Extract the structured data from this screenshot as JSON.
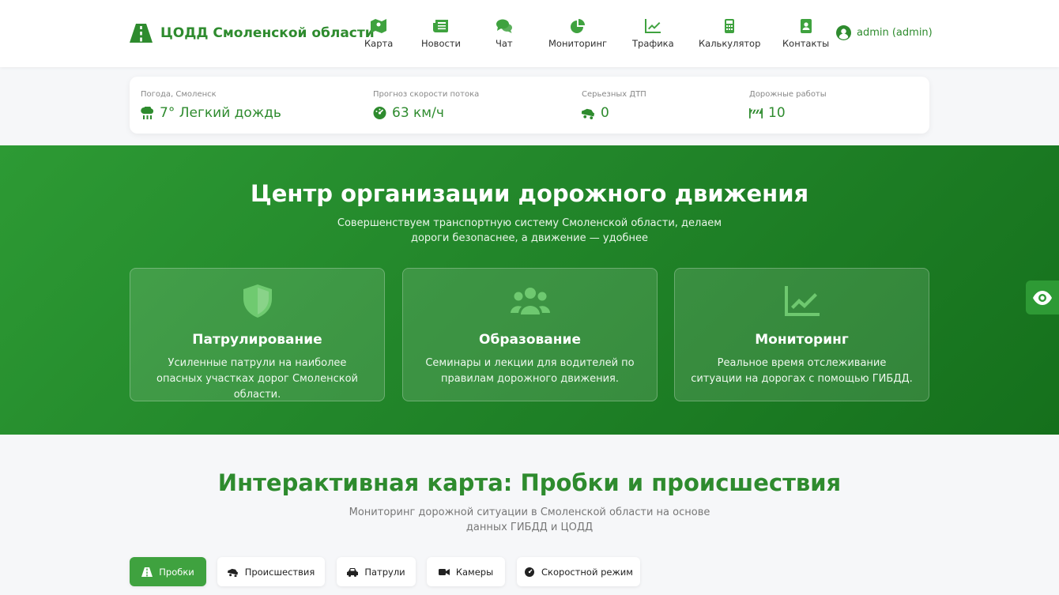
{
  "header": {
    "logo_text": "ЦОДД Смоленской области",
    "nav": [
      {
        "label": "Карта",
        "icon": "map-icon"
      },
      {
        "label": "Новости",
        "icon": "newspaper-icon"
      },
      {
        "label": "Чат",
        "icon": "chat-icon"
      },
      {
        "label": "Мониторинг",
        "icon": "pie-chart-icon"
      },
      {
        "label": "Трафика",
        "icon": "line-chart-icon"
      },
      {
        "label": "Калькулятор",
        "icon": "calculator-icon"
      },
      {
        "label": "Контакты",
        "icon": "contact-book-icon"
      }
    ],
    "user_label": "admin (admin)"
  },
  "infobar": [
    {
      "caption": "Погода, Смоленск",
      "value": "7°  Легкий дождь",
      "icon": "cloud-rain-icon"
    },
    {
      "caption": "Прогноз скорости потока",
      "value": "63 км/ч",
      "icon": "speedometer-icon"
    },
    {
      "caption": "Серьезных ДТП",
      "value": "0",
      "icon": "car-crash-icon"
    },
    {
      "caption": "Дорожные работы",
      "value": "10",
      "icon": "road-barrier-icon"
    }
  ],
  "hero": {
    "title": "Центр организации дорожного движения",
    "subtitle": "Совершенствуем транспортную систему Смоленской области, делаем дороги безопаснее, а движение — удобнее",
    "cards": [
      {
        "title": "Патрулирование",
        "desc": "Усиленные патрули на наиболее опасных участках дорог Смоленской области.",
        "icon": "shield-icon"
      },
      {
        "title": "Образование",
        "desc": "Семинары и лекции для водителей по правилам дорожного движения.",
        "icon": "users-icon"
      },
      {
        "title": "Мониторинг",
        "desc": "Реальное время отслеживание ситуации на дорогах с помощью ГИБДД.",
        "icon": "chart-line-icon"
      }
    ]
  },
  "map_section": {
    "title": "Интерактивная карта: Пробки и происшествия",
    "subtitle": "Мониторинг дорожной ситуации в Смоленской области на основе данных ГИБДД и ЦОДД",
    "filters": [
      {
        "label": "Пробки",
        "icon": "road-icon",
        "active": true
      },
      {
        "label": "Происшествия",
        "icon": "car-crash-icon",
        "active": false
      },
      {
        "label": "Патрули",
        "icon": "car-icon",
        "active": false
      },
      {
        "label": "Камеры",
        "icon": "video-camera-icon",
        "active": false
      },
      {
        "label": "Скоростной режим",
        "icon": "speedometer-icon",
        "active": false
      }
    ]
  },
  "colors": {
    "brand": "#2e8b2e",
    "accent": "#3fa23f",
    "hero_start": "#2d9a34",
    "hero_end": "#15701c"
  }
}
